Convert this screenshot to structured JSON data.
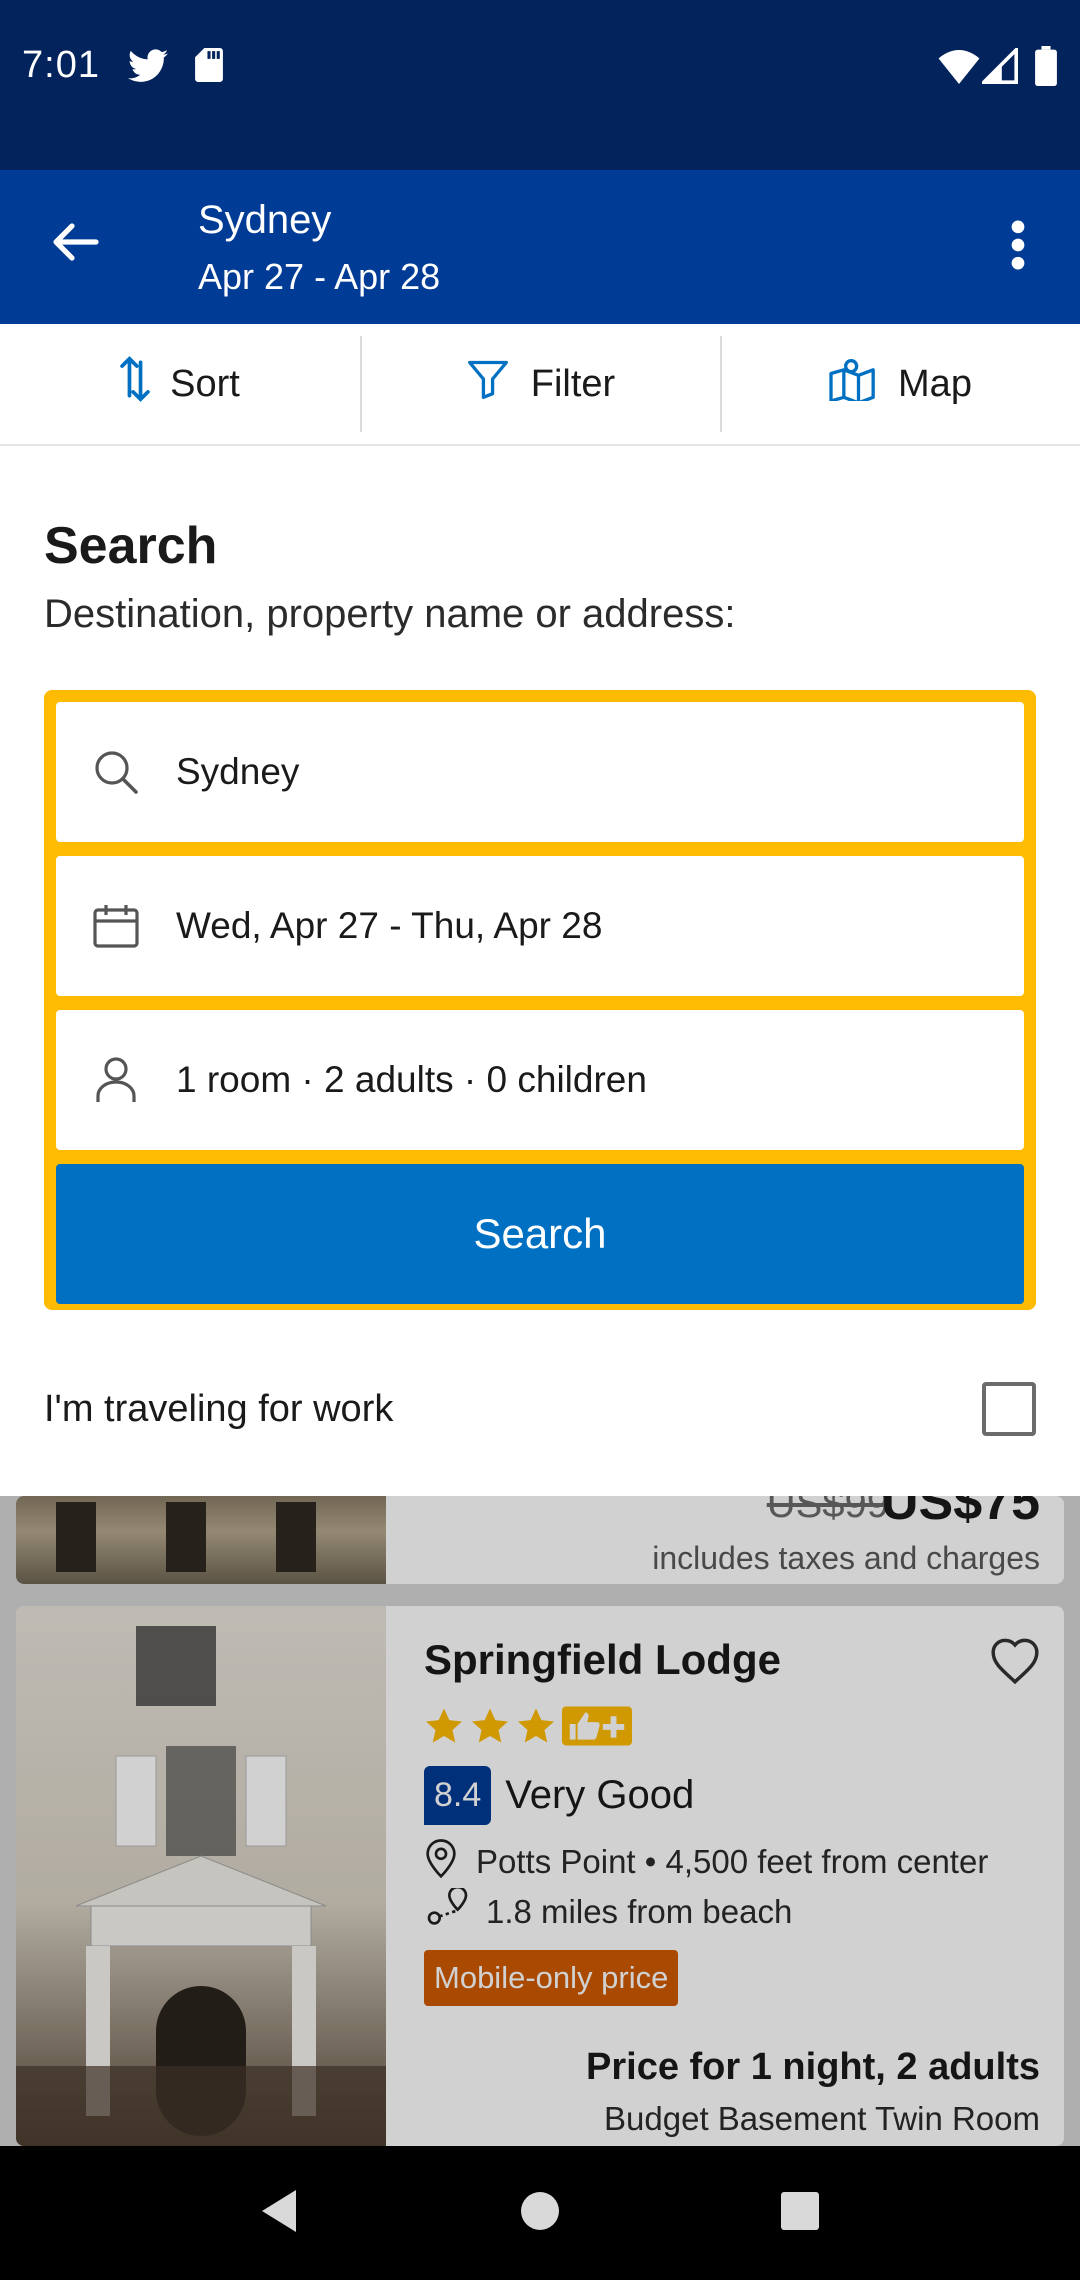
{
  "status_bar": {
    "time": "7:01",
    "icons": [
      "twitter-icon",
      "sd-card-icon",
      "wifi-icon",
      "signal-icon",
      "battery-icon"
    ]
  },
  "app_bar": {
    "title": "Sydney",
    "subtitle": "Apr 27 - Apr 28"
  },
  "toolbar": {
    "sort_label": "Sort",
    "filter_label": "Filter",
    "map_label": "Map"
  },
  "search_panel": {
    "heading": "Search",
    "subheading": "Destination, property name or address:",
    "destination": "Sydney",
    "dates": "Wed, Apr 27 - Thu, Apr 28",
    "occupancy": "1 room · 2 adults · 0 children",
    "search_button": "Search",
    "work_travel_label": "I'm traveling for work",
    "work_travel_checked": false
  },
  "results": [
    {
      "old_price": "US$99",
      "price": "US$75",
      "tax_note": "includes taxes and charges"
    },
    {
      "name": "Springfield Lodge",
      "stars": 3,
      "score": "8.4",
      "score_label": "Very Good",
      "location": "Potts Point • 4,500 feet from center",
      "beach_distance": "1.8 miles from beach",
      "badge": "Mobile-only price",
      "price_for": "Price for 1 night, 2 adults",
      "room_type": "Budget Basement Twin Room"
    }
  ],
  "colors": {
    "status_bar": "#03235c",
    "app_bar": "#003b95",
    "search_border": "#febb02",
    "search_button": "#0071c2",
    "badge": "#d05a00",
    "star": "#febb02"
  }
}
